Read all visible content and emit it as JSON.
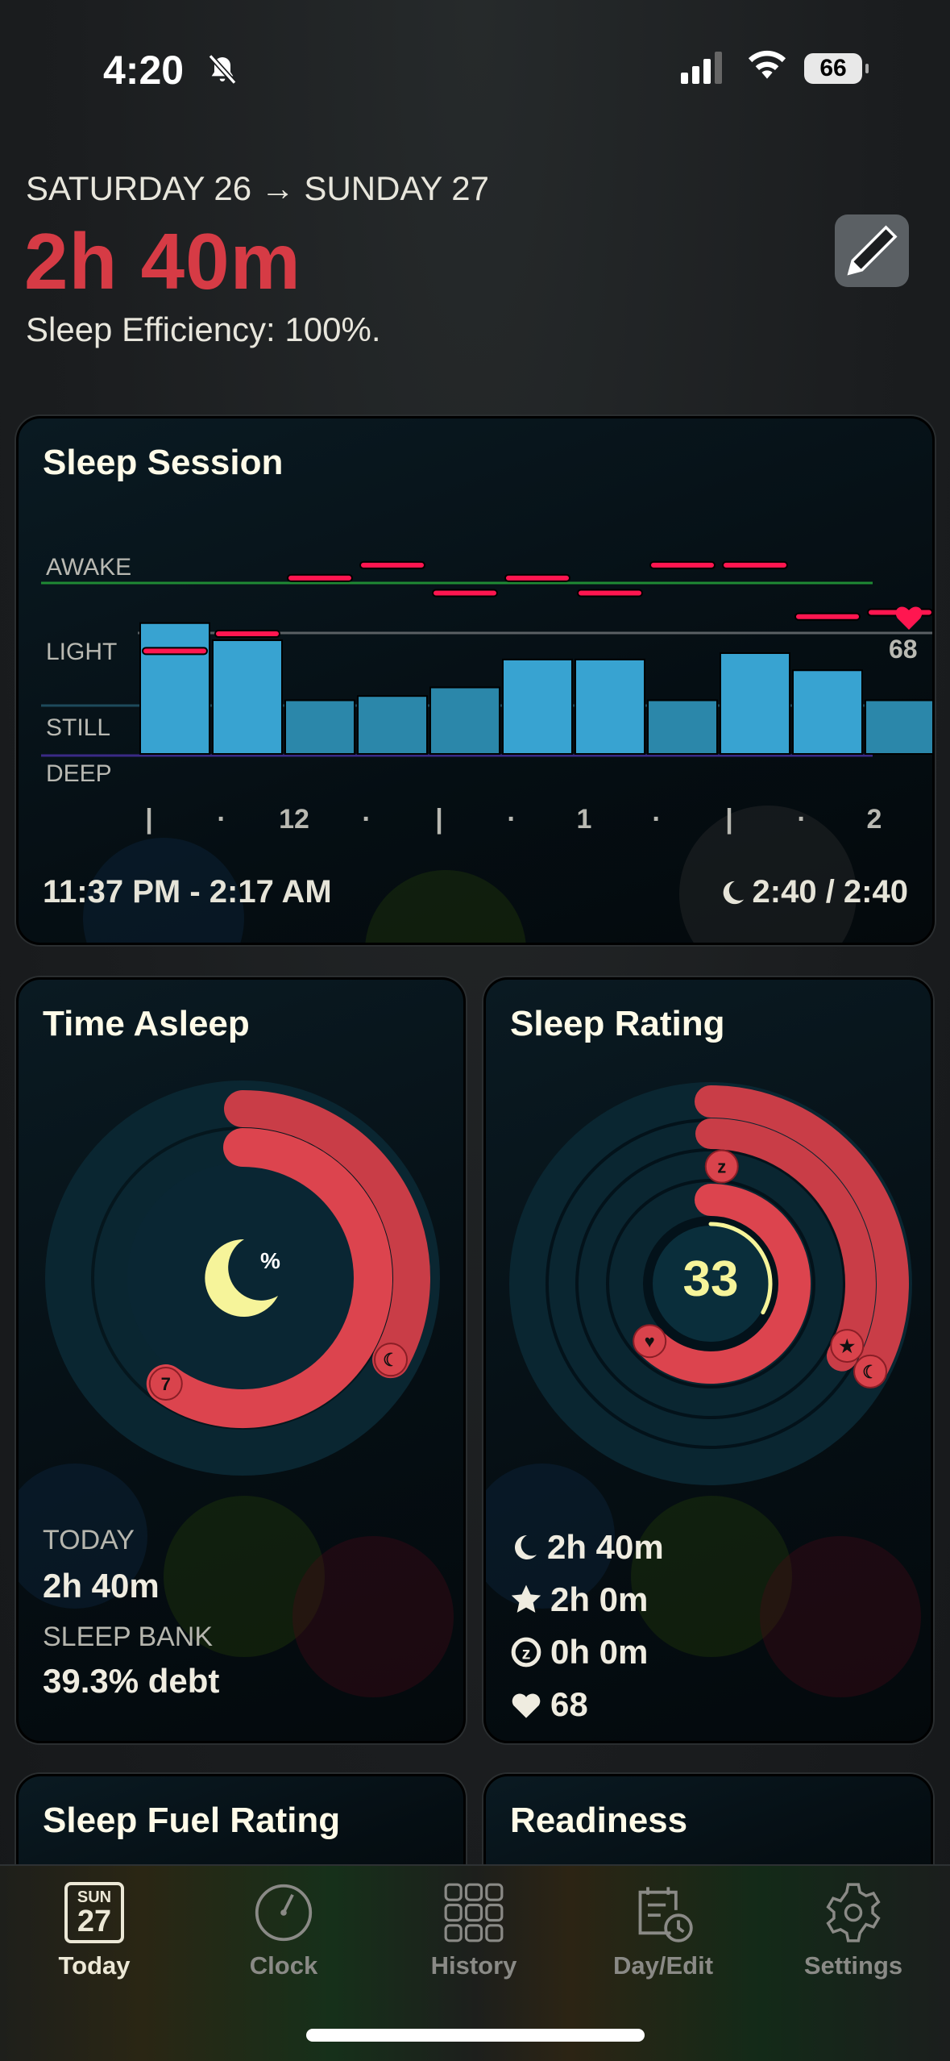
{
  "status_bar": {
    "time": "4:20",
    "battery": "66",
    "silent_icon": "bell-slash-icon",
    "signal_bars": 3,
    "signal_max": 4
  },
  "header": {
    "date_range": "SATURDAY 26 → SUNDAY 27",
    "duration": "2h 40m",
    "efficiency": "Sleep Efficiency: 100%.",
    "edit_icon": "pencil-icon"
  },
  "colors": {
    "accent_red": "#d63b45",
    "awake_line": "#1f8a34",
    "bar_light": "#38a3d1",
    "bar_dark": "#2b87aa",
    "heart_rate": "#ff1650",
    "rating_yellow": "#f6f49a"
  },
  "sleep_session": {
    "title": "Sleep Session",
    "stage_labels": [
      "AWAKE",
      "LIGHT",
      "STILL",
      "DEEP"
    ],
    "ticks": [
      "|",
      "·",
      "12",
      "·",
      "|",
      "·",
      "1",
      "·",
      "|",
      "·",
      "2"
    ],
    "time_range": "11:37 PM - 2:17 AM",
    "asleep_ratio": "2:40 / 2:40",
    "heart_rate_last": "68",
    "movement_levels": [
      0.61,
      0.53,
      0.25,
      0.27,
      0.31,
      0.44,
      0.44,
      0.25,
      0.47,
      0.39,
      0.25
    ],
    "heart_rate_levels": [
      0.48,
      0.56,
      0.82,
      0.88,
      0.75,
      0.82,
      0.75,
      0.88,
      0.88,
      0.64,
      0.66
    ]
  },
  "time_asleep": {
    "title": "Time Asleep",
    "center_icon": "moon-percent-icon",
    "outer_progress": 0.33,
    "inner_progress": 0.6,
    "inner_marker": "7",
    "today_label": "TODAY",
    "today_value": "2h 40m",
    "bank_label": "SLEEP BANK",
    "bank_value": "39.3% debt"
  },
  "sleep_rating": {
    "title": "Sleep Rating",
    "score": "33",
    "score_fraction": 0.33,
    "rings": [
      {
        "icon": "moon-icon",
        "progress": 0.33
      },
      {
        "icon": "star-icon",
        "progress": 0.33
      },
      {
        "icon": "zzz-icon",
        "progress": 0.0
      },
      {
        "icon": "heart-icon",
        "progress": 0.63
      }
    ],
    "stats": [
      {
        "icon": "moon-icon",
        "value": "2h 40m"
      },
      {
        "icon": "star-icon",
        "value": "2h 0m"
      },
      {
        "icon": "zzz-icon",
        "value": "0h 0m"
      },
      {
        "icon": "heart-icon",
        "value": "68"
      }
    ]
  },
  "lower_cards": [
    {
      "title": "Sleep Fuel Rating"
    },
    {
      "title": "Readiness"
    }
  ],
  "tabs": [
    {
      "label": "Today",
      "icon": "calendar-day-icon",
      "day": "SUN",
      "date": "27",
      "active": true
    },
    {
      "label": "Clock",
      "icon": "clock-gauge-icon"
    },
    {
      "label": "History",
      "icon": "grid-icon"
    },
    {
      "label": "Day/Edit",
      "icon": "calendar-clock-icon"
    },
    {
      "label": "Settings",
      "icon": "gear-icon"
    }
  ]
}
